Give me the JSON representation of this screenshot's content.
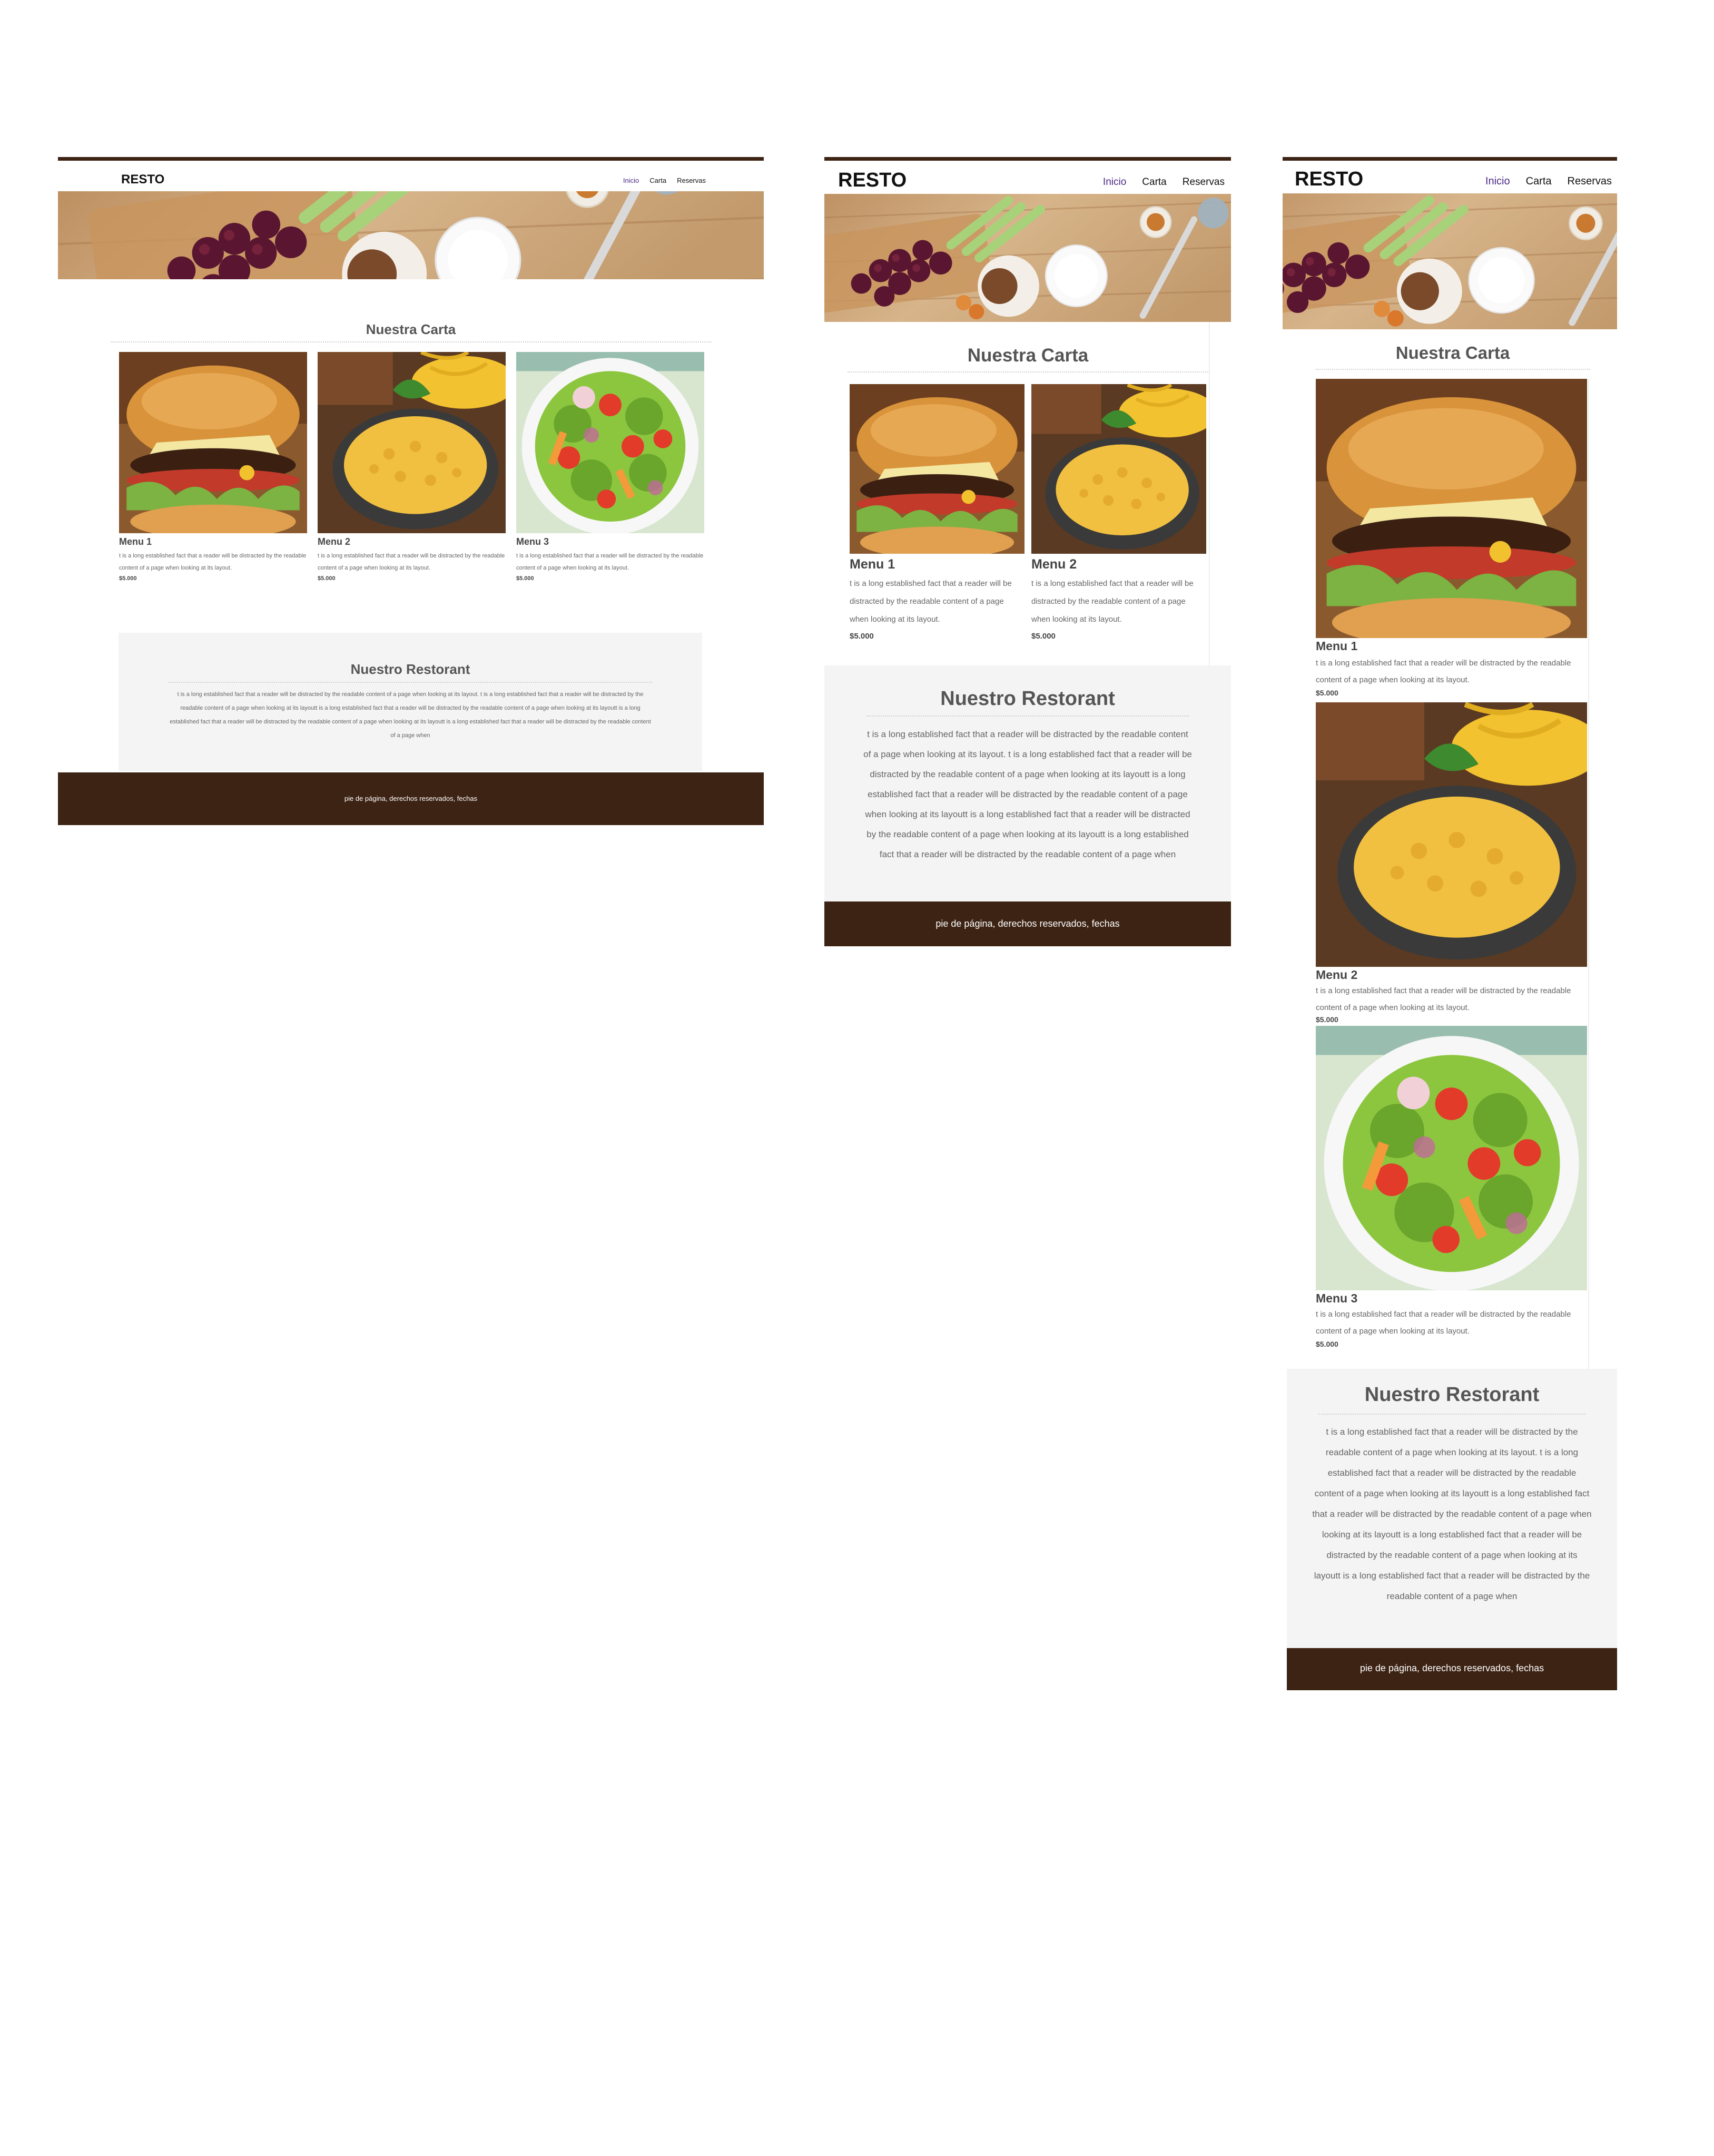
{
  "site": {
    "logo": "RESTO",
    "nav": [
      "Inicio",
      "Carta",
      "Reservas"
    ],
    "active_nav": "Inicio"
  },
  "carta": {
    "title": "Nuestra Carta",
    "items": [
      {
        "name": "Menu 1",
        "description": "t is a long established fact that a reader will be distracted by the readable content of a page when looking at its layout.",
        "price": "$5.000",
        "image": "burger"
      },
      {
        "name": "Menu 2",
        "description": "t is a long established fact that a reader will be distracted by the readable content of a page when looking at its layout.",
        "price": "$5.000",
        "image": "pie"
      },
      {
        "name": "Menu 3",
        "description": "t is a long established fact that a reader will be distracted by the readable content of a page when looking at its layout.",
        "price": "$5.000",
        "image": "salad"
      }
    ]
  },
  "restorant": {
    "title": "Nuestro Restorant",
    "text": "t is a long established fact that a reader will be distracted by the readable content of a page when looking at its layout. t is a long established fact that a reader will be distracted by the readable content of a page when looking at its layoutt is a long established fact that a reader will be distracted by the readable content of a page when looking at its layoutt is a long established fact that a reader will be distracted by the readable content of a page when looking at its layoutt is a long established fact that a reader will be distracted by the readable content of a page when"
  },
  "footer": {
    "text": "pie de página, derechos reservados, fechas"
  },
  "mockups": [
    {
      "label": "desktop"
    },
    {
      "label": "tablet"
    },
    {
      "label": "mobile"
    }
  ],
  "colors": {
    "brand_dark": "#3d2314",
    "nav_active": "#4b2a86",
    "section_bg": "#f4f4f4",
    "page_bg": "#ffffff"
  },
  "icons": {
    "hero": "food-board-image",
    "menu_images": [
      "burger-image",
      "pie-image",
      "salad-image"
    ]
  }
}
